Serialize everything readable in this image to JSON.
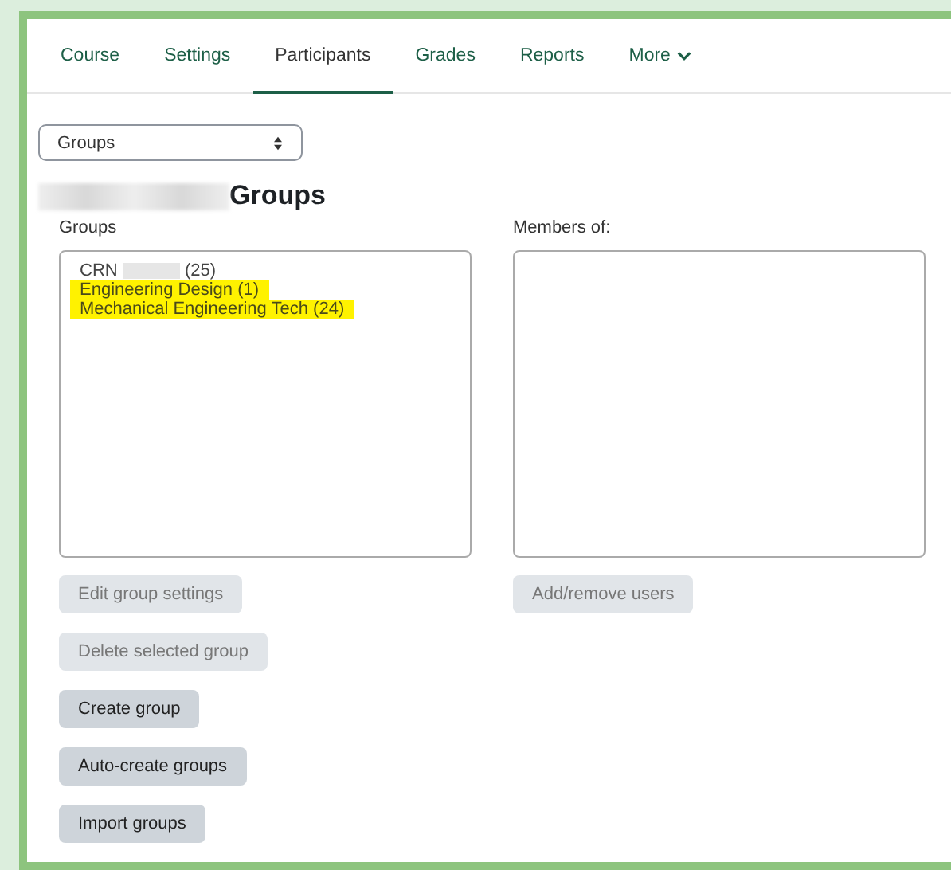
{
  "tabs": [
    {
      "label": "Course",
      "selected": false
    },
    {
      "label": "Settings",
      "selected": false
    },
    {
      "label": "Participants",
      "selected": true
    },
    {
      "label": "Grades",
      "selected": false
    },
    {
      "label": "Reports",
      "selected": false
    },
    {
      "label": "More",
      "selected": false,
      "dropdown": true
    }
  ],
  "page_select": {
    "value": "Groups"
  },
  "heading": {
    "redacted_prefix": true,
    "text": "Groups"
  },
  "groups": {
    "label": "Groups",
    "items": [
      {
        "kind": "redacted",
        "prefix": "CRN",
        "suffix": "(25)",
        "highlighted": false
      },
      {
        "kind": "plain",
        "text": "Engineering Design (1)",
        "highlighted": true
      },
      {
        "kind": "plain",
        "text": "Mechanical Engineering Tech (24)",
        "highlighted": true
      }
    ],
    "buttons": [
      {
        "label": "Edit group settings",
        "disabled": true
      },
      {
        "label": "Delete selected group",
        "disabled": true
      },
      {
        "label": "Create group",
        "disabled": false
      },
      {
        "label": "Auto-create groups",
        "disabled": false
      },
      {
        "label": "Import groups",
        "disabled": false
      }
    ]
  },
  "members": {
    "label": "Members of:",
    "buttons": [
      {
        "label": "Add/remove users",
        "disabled": true
      }
    ]
  }
}
